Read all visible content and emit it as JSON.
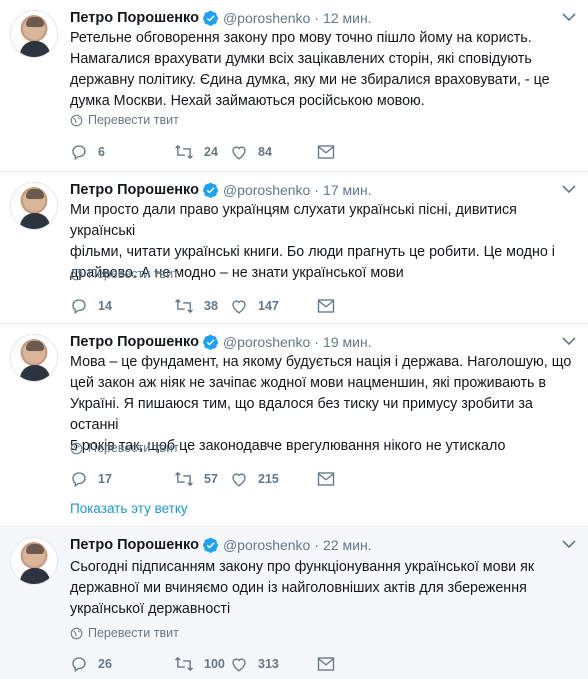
{
  "author": {
    "name": "Петро Порошенко",
    "handle": "@poroshenko"
  },
  "translate_label": "Перевести твит",
  "thread_link_label": "Показать эту ветку",
  "colors": {
    "accent": "#1da1f2",
    "link": "#1b95e0",
    "muted": "#657786",
    "text": "#14171a",
    "divider": "#e6ecf0",
    "highlight_bg": "#f5f8fa"
  },
  "icons": [
    "verified-badge-icon",
    "caret-down-icon",
    "globe-icon",
    "reply-icon",
    "retweet-icon",
    "like-icon",
    "message-icon"
  ],
  "tweets": [
    {
      "time": "12 мин.",
      "text": "Ретельне обговорення закону про мову точно пішло йому на користь.\nНамагалися врахувати думки всіх зацікавлених сторін, які сповідують\nдержавну політику. Єдина думка, яку ми не збиралися враховувати, - це\nдумка Москви. Нехай займаються російською мовою.",
      "replies": "6",
      "retweets": "24",
      "likes": "84"
    },
    {
      "time": "17 мин.",
      "text": "Ми просто дали право українцям слухати українські пісні, дивитися українські\nфільми, читати українські книги. Бо люди прагнуть це робити. Це модно і\nдрайвово. А не модно – не знати української мови",
      "replies": "14",
      "retweets": "38",
      "likes": "147"
    },
    {
      "time": "19 мин.",
      "text": "Мова – це фундамент, на якому будується нація і держава. Наголошую, що\nцей закон аж ніяк не зачіпає жодної мови нацменшин, які проживають в\nУкраїні. Я пишаюся тим, що вдалося без тиску чи примусу зробити за останні\n5 років так, щоб це законодавче врегулювання нікого не утискало",
      "replies": "17",
      "retweets": "57",
      "likes": "215"
    },
    {
      "time": "22 мин.",
      "text": "Сьогодні підписанням закону про функціонування української мови як\nдержавної ми вчиняємо один із найголовніших актів для збереження\nукраїнської державності",
      "replies": "26",
      "retweets": "100",
      "likes": "313"
    }
  ]
}
